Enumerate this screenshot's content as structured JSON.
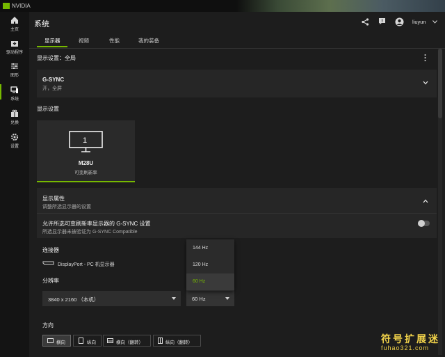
{
  "app": {
    "name": "NVIDIA"
  },
  "sidebar": {
    "items": [
      {
        "label": "主页"
      },
      {
        "label": "驱动程序"
      },
      {
        "label": "图形"
      },
      {
        "label": "系统"
      },
      {
        "label": "兑换"
      },
      {
        "label": "设置"
      }
    ]
  },
  "header": {
    "title": "系统",
    "user": "liuyun"
  },
  "tabs": [
    {
      "label": "显示器"
    },
    {
      "label": "视频"
    },
    {
      "label": "性能"
    },
    {
      "label": "我的装备"
    }
  ],
  "display_settings_scope": "显示设置：全局",
  "gsync": {
    "title": "G-SYNC",
    "value": "开，全屏"
  },
  "display_section_title": "显示设置",
  "monitor": {
    "number": "1",
    "name": "M28U",
    "subtitle": "可变刷新率"
  },
  "properties": {
    "title": "显示属性",
    "subtitle": "调整所选显示器的设置"
  },
  "vrr_setting": {
    "title": "允许所选可变刷新率显示器的 G-SYNC 设置",
    "subtitle": "所选显示器未被验证为 G-SYNC Compatible",
    "enabled": false
  },
  "connector": {
    "label": "连接器",
    "value": "DisplayPort - PC 机显示器"
  },
  "resolution": {
    "label": "分辨率",
    "value": "3840 x 2160 （本机）"
  },
  "refresh": {
    "value": "60 Hz",
    "options": [
      "144 Hz",
      "120 Hz",
      "60 Hz"
    ],
    "selected": "60 Hz"
  },
  "orientation": {
    "label": "方向",
    "options": [
      "横向",
      "纵向",
      "横向（翻转）",
      "纵向（翻转）"
    ],
    "selected": "横向"
  },
  "watermark": {
    "line1": "符号扩展迷",
    "line2": "fuhao321.com"
  },
  "colors": {
    "accent": "#76b900",
    "background": "#1d1d1d",
    "panel": "#262626",
    "watermark": "#f2d34a"
  }
}
